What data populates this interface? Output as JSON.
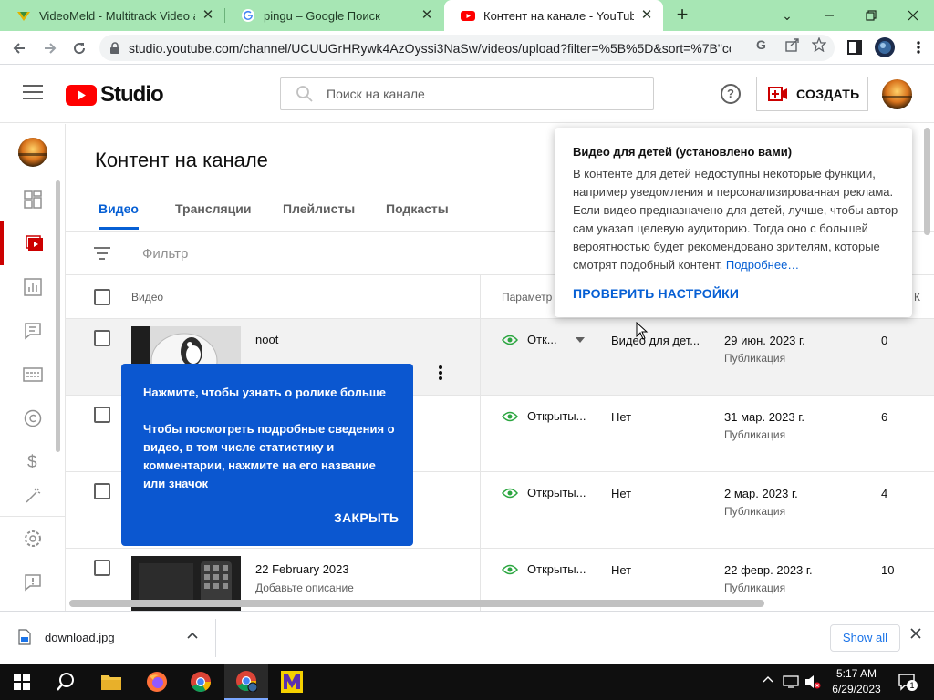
{
  "browser": {
    "tabs": [
      {
        "title": "VideoMeld - Multitrack Video and",
        "icon": "videomeld-favicon"
      },
      {
        "title": "pingu – Google Поиск",
        "icon": "google-favicon"
      },
      {
        "title": "Контент на канале - YouTube Stu",
        "icon": "youtube-favicon",
        "active": true
      }
    ],
    "url": "studio.youtube.com/channel/UCUUGrHRywk4AzOyssi3NaSw/videos/upload?filter=%5B%5D&sort=%7B\"col..."
  },
  "studio": {
    "logo_text": "Studio",
    "search_placeholder": "Поиск на канале",
    "help_glyph": "?",
    "create_label": "СОЗДАТЬ",
    "brand_color": "#ff0000"
  },
  "sidebar": {
    "items": [
      {
        "icon": "dashboard-icon"
      },
      {
        "icon": "content-icon",
        "active": true
      },
      {
        "icon": "analytics-icon"
      },
      {
        "icon": "comments-icon"
      },
      {
        "icon": "subtitles-icon"
      },
      {
        "icon": "copyright-icon"
      },
      {
        "icon": "monetization-icon"
      },
      {
        "icon": "customization-icon"
      },
      {
        "icon": "settings-icon"
      },
      {
        "icon": "feedback-icon"
      }
    ]
  },
  "content": {
    "page_title": "Контент на канале",
    "tabs": [
      "Видео",
      "Трансляции",
      "Плейлисты",
      "Подкасты"
    ],
    "filter_label": "Фильтр",
    "columns": {
      "video": "Видео",
      "params": "Параметр",
      "views_partial": "К"
    },
    "rows": [
      {
        "title": "noot",
        "description": "",
        "visibility": "Отк...",
        "kids": "Видео для дет...",
        "date": "29 июн. 2023 г.",
        "status": "Публикация",
        "views": "0"
      },
      {
        "title": "",
        "description": "",
        "visibility": "Открыты...",
        "kids": "Нет",
        "date": "31 мар. 2023 г.",
        "status": "Публикация",
        "views": "6"
      },
      {
        "title": "",
        "description": "",
        "visibility": "Открыты...",
        "kids": "Нет",
        "date": "2 мар. 2023 г.",
        "status": "Публикация",
        "views": "4"
      },
      {
        "title": "22 February 2023",
        "description": "Добавьте описание",
        "visibility": "Открыты...",
        "kids": "Нет",
        "date": "22 февр. 2023 г.",
        "status": "Публикация",
        "views": "10"
      }
    ]
  },
  "kids_popover": {
    "title": "Видео для детей (установлено вами)",
    "body": "В контенте для детей недоступны некоторые функции, например уведомления и персонализированная реклама. Если видео предназначено для детей, лучше, чтобы автор сам указал целевую аудиторию. Тогда оно с большей вероятностью будет рекомендовано зрителям, которые смотрят подобный контент.",
    "link": "Подробнее…",
    "button": "ПРОВЕРИТЬ НАСТРОЙКИ"
  },
  "tooltip": {
    "title": "Нажмите, чтобы узнать о ролике больше",
    "body": "Чтобы посмотреть подробные сведения о видео, в том числе статистику и комментарии, нажмите на его название или значок",
    "close": "ЗАКРЫТЬ"
  },
  "downloads": {
    "file": "download.jpg",
    "show_all": "Show all"
  },
  "taskbar": {
    "time": "5:17 AM",
    "date": "6/29/2023",
    "notifications": "1"
  }
}
